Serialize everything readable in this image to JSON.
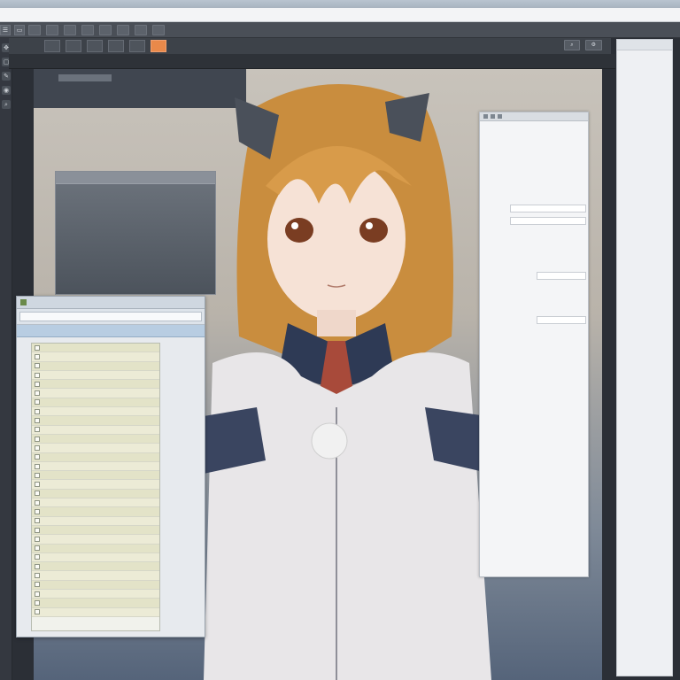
{
  "window": {
    "title": ""
  },
  "menubar": {
    "items": [
      "",
      "",
      "",
      "",
      "",
      "",
      "",
      "",
      "",
      "",
      "",
      "",
      ""
    ]
  },
  "toolbar1": {
    "buttons": [
      "",
      "",
      "",
      "",
      "",
      "",
      "",
      ""
    ]
  },
  "toolbar2": {
    "tabs": [
      "",
      "",
      "",
      "",
      "",
      ""
    ],
    "active_index": 5
  },
  "toolbar3": {
    "labels": [
      "",
      "",
      ""
    ]
  },
  "right_panel": {
    "items": [
      "",
      "",
      "",
      "",
      "",
      "",
      "",
      ""
    ]
  },
  "float_panel": {
    "title": ""
  },
  "list_window": {
    "title": "",
    "address": "",
    "columns": [
      "",
      ""
    ],
    "row_count": 30
  },
  "colors": {
    "accent": "#e9894a",
    "panel_dark": "#2b2f36",
    "list_header": "#b8cde2"
  },
  "icons": [
    "menu-icon",
    "folder-icon",
    "gear-icon",
    "search-icon",
    "close-icon"
  ]
}
